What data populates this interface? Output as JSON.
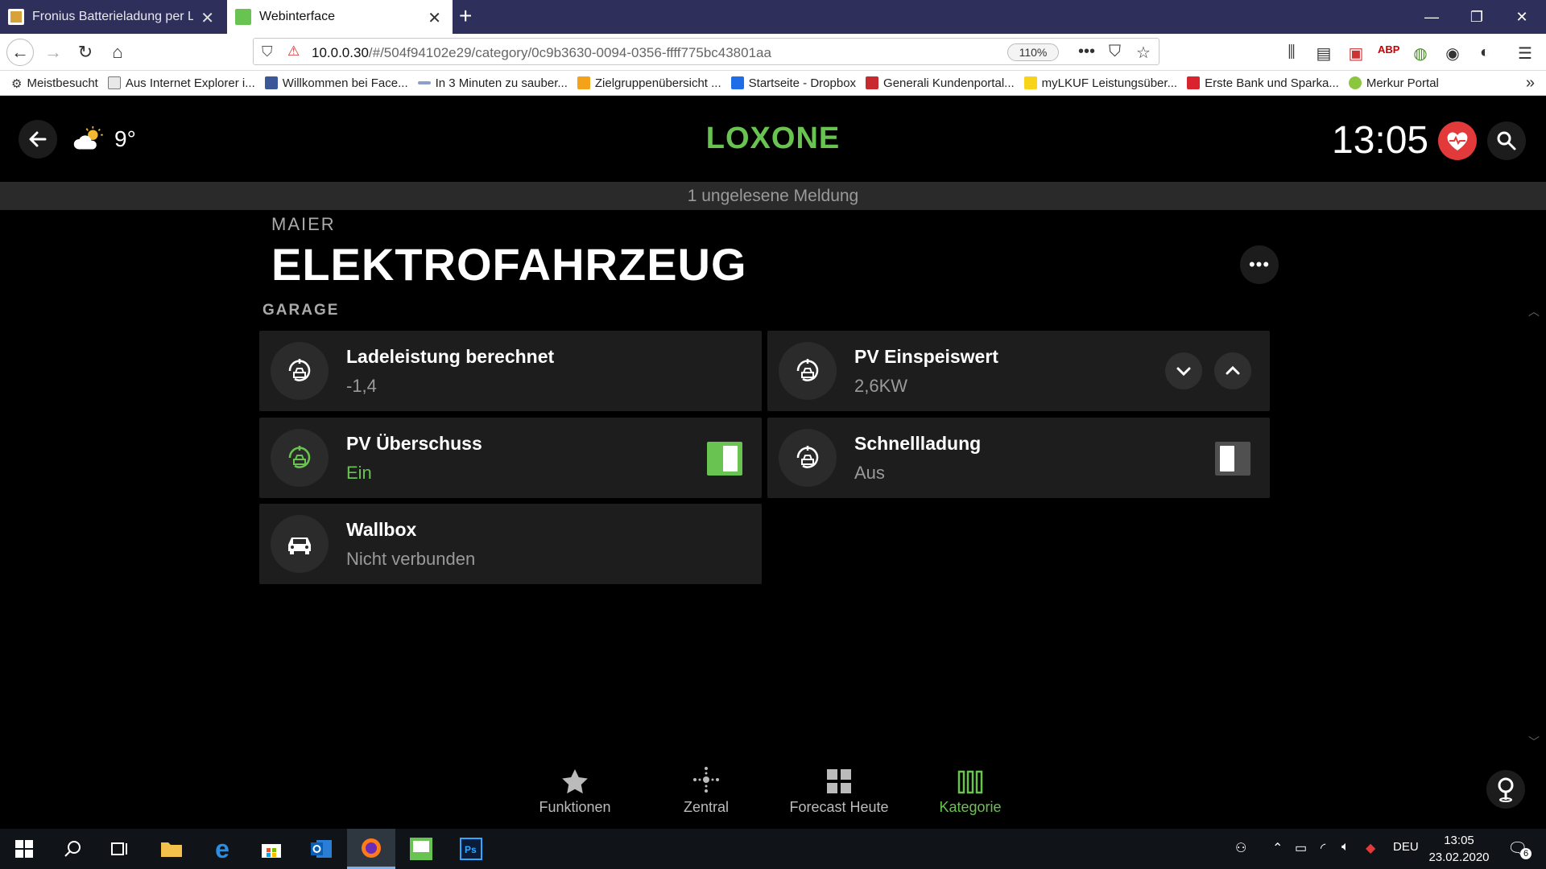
{
  "browser": {
    "tabs": [
      {
        "title": "Fronius Batterieladung per Lox",
        "active": false
      },
      {
        "title": "Webinterface",
        "active": true
      }
    ],
    "url_host": "10.0.0.30",
    "url_path": "/#/504f94102e29/category/0c9b3630-0094-0356-ffff775bc43801aa",
    "zoom": "110%",
    "bookmarks": [
      "Meistbesucht",
      "Aus Internet Explorer i...",
      "Willkommen bei Face...",
      "In 3 Minuten zu sauber...",
      "Zielgruppenübersicht ...",
      "Startseite - Dropbox",
      "Generali Kundenportal...",
      "myLKUF Leistungsüber...",
      "Erste Bank und Sparka...",
      "Merkur Portal"
    ]
  },
  "app": {
    "logo": "LOXONE",
    "temperature": "9°",
    "time": "13:05",
    "notification": "1 ungelesene Meldung",
    "room": "MAIER",
    "title": "ELEKTROFAHRZEUG",
    "group": "GARAGE",
    "cards": [
      {
        "name": "Ladeleistung berechnet",
        "value": "-1,4",
        "icon": "ev-charger-icon"
      },
      {
        "name": "PV Einspeiswert",
        "value": "2,6KW",
        "icon": "ev-charger-icon"
      },
      {
        "name": "PV Überschuss",
        "value": "Ein",
        "icon": "ev-charger-icon",
        "switch": "on"
      },
      {
        "name": "Schnellladung",
        "value": "Aus",
        "icon": "ev-charger-icon",
        "switch": "off"
      },
      {
        "name": "Wallbox",
        "value": "Nicht verbunden",
        "icon": "car-icon"
      }
    ],
    "bottom_nav": [
      {
        "label": "Funktionen",
        "icon": "star-icon"
      },
      {
        "label": "Zentral",
        "icon": "central-icon"
      },
      {
        "label": "Forecast Heute",
        "icon": "grid-icon"
      },
      {
        "label": "Kategorie",
        "icon": "category-icon",
        "active": true
      }
    ],
    "accent_color": "#69c350",
    "alert_color": "#e23a3a"
  },
  "taskbar": {
    "language": "DEU",
    "time": "13:05",
    "date": "23.02.2020",
    "notifications": "6"
  }
}
